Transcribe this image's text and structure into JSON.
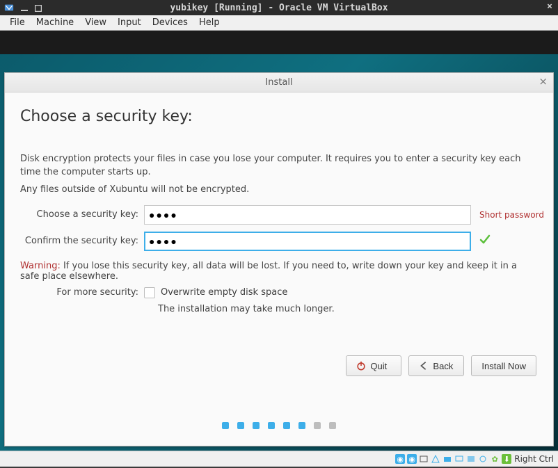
{
  "vm": {
    "title": "yubikey [Running] - Oracle VM VirtualBox",
    "menu": [
      "File",
      "Machine",
      "View",
      "Input",
      "Devices",
      "Help"
    ],
    "host_key": "Right Ctrl"
  },
  "dialog": {
    "title": "Install",
    "heading": "Choose a security key:",
    "para1": "Disk encryption protects your files in case you lose your computer. It requires you to enter a security key each time the computer starts up.",
    "para2": "Any files outside of Xubuntu will not be encrypted.",
    "field1_label": "Choose a security key:",
    "field1_value": "●●●●",
    "field1_hint": "Short password",
    "field2_label": "Confirm the security key:",
    "field2_value": "●●●●",
    "warning_label": "Warning:",
    "warning_text": " If you lose this security key, all data will be lost. If you need to, write down your key and keep it in a safe place elsewhere.",
    "more_security_label": "For more security:",
    "overwrite_label": "Overwrite empty disk space",
    "overwrite_note": "The installation may take much longer.",
    "buttons": {
      "quit": "Quit",
      "back": "Back",
      "install": "Install Now"
    },
    "progress": {
      "active": 6,
      "total": 8
    }
  }
}
